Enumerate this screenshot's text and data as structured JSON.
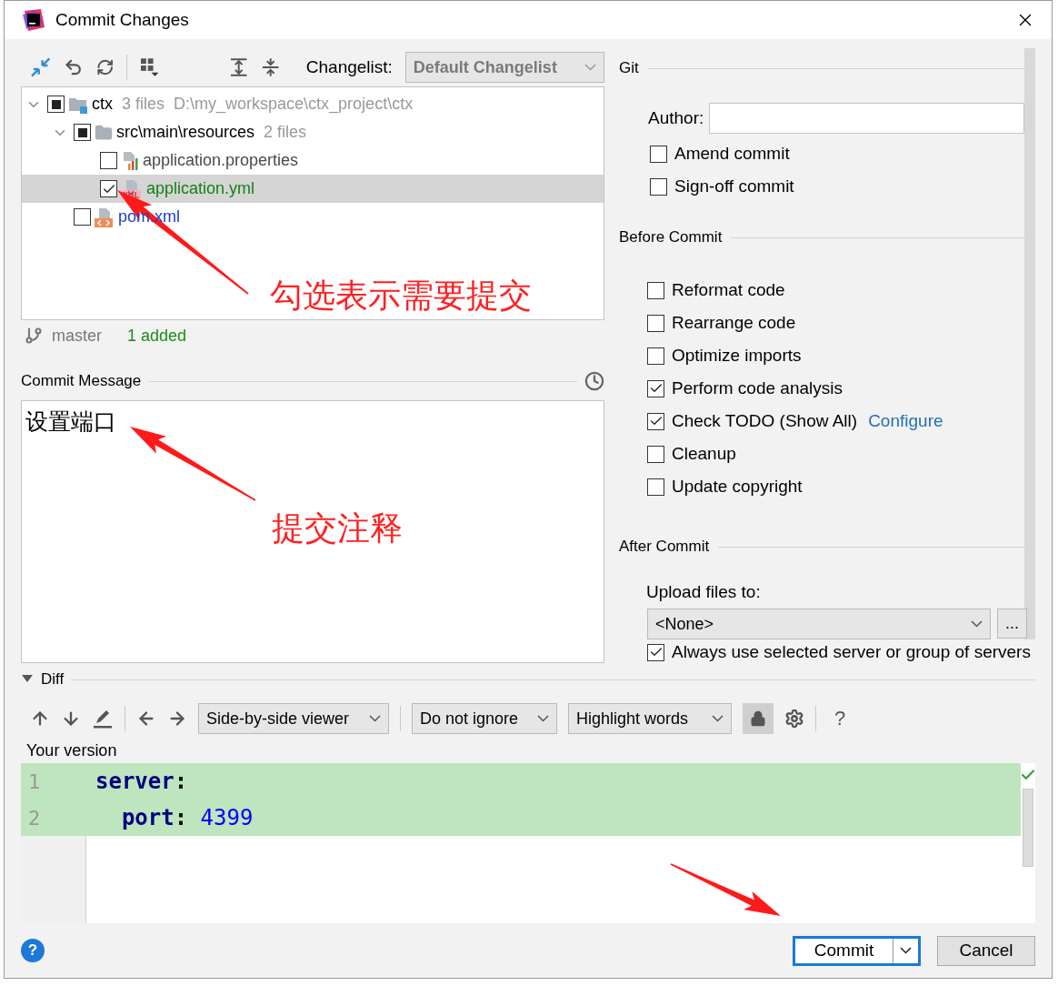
{
  "window": {
    "title": "Commit Changes"
  },
  "changelist": {
    "label": "Changelist:",
    "value": "Default Changelist"
  },
  "tree": [
    {
      "name": "ctx",
      "kind": "module",
      "checked": false,
      "partial": true,
      "expanded": true,
      "color": "#000000",
      "selected": false,
      "details": [
        "3 files",
        "D:\\my_workspace\\ctx_project\\ctx"
      ],
      "children": [
        {
          "name": "src\\main\\resources",
          "kind": "folder",
          "checked": false,
          "partial": true,
          "expanded": true,
          "color": "#000000",
          "selected": false,
          "details": [
            "2 files"
          ],
          "children": [
            {
              "name": "application.properties",
              "kind": "properties",
              "checked": false,
              "partial": false,
              "color": "#4a4a4a",
              "selected": false
            },
            {
              "name": "application.yml",
              "kind": "yml",
              "checked": true,
              "partial": false,
              "color": "#148014",
              "selected": true
            }
          ]
        },
        {
          "name": "pom.xml",
          "kind": "xml",
          "checked": false,
          "partial": false,
          "color": "#1a3cc8",
          "selected": false
        }
      ]
    }
  ],
  "branch": {
    "name": "master",
    "summary": "1 added"
  },
  "commit_message": {
    "label": "Commit Message",
    "value": "设置端口"
  },
  "git": {
    "title": "Git",
    "author_label": "Author:",
    "options": [
      {
        "label": "Amend commit",
        "checked": false
      },
      {
        "label": "Sign-off commit",
        "checked": false
      }
    ]
  },
  "before_commit": {
    "title": "Before Commit",
    "options": [
      {
        "label": "Reformat code",
        "checked": false
      },
      {
        "label": "Rearrange code",
        "checked": false
      },
      {
        "label": "Optimize imports",
        "checked": false
      },
      {
        "label": "Perform code analysis",
        "checked": true
      },
      {
        "label": "Check TODO (Show All)",
        "checked": true,
        "link": "Configure"
      },
      {
        "label": "Cleanup",
        "checked": false
      },
      {
        "label": "Update copyright",
        "checked": false
      }
    ]
  },
  "after_commit": {
    "title": "After Commit",
    "upload_label": "Upload files to:",
    "upload_value": "<None>",
    "browse": "...",
    "options": [
      {
        "label": "Always use selected server or group of servers",
        "checked": true
      }
    ]
  },
  "diff": {
    "title": "Diff",
    "expanded": true,
    "viewer": "Side-by-side viewer",
    "ignore": "Do not ignore",
    "highlight": "Highlight words",
    "locked": true,
    "help": "?",
    "side_label": "Your version",
    "lines": [
      {
        "number": "1",
        "changed": true,
        "tokens": [
          {
            "kind": "key",
            "text": "server"
          },
          {
            "kind": "punct",
            "text": ":"
          }
        ]
      },
      {
        "number": "2",
        "changed": true,
        "tokens": [
          {
            "kind": "key",
            "text": "  port"
          },
          {
            "kind": "punct",
            "text": ": "
          },
          {
            "kind": "number",
            "text": "4399"
          }
        ]
      }
    ]
  },
  "buttons": {
    "help": "?",
    "commit": "Commit",
    "cancel": "Cancel"
  },
  "annotations": [
    {
      "text": "勾选表示需要提交"
    },
    {
      "text": "提交注释"
    }
  ]
}
